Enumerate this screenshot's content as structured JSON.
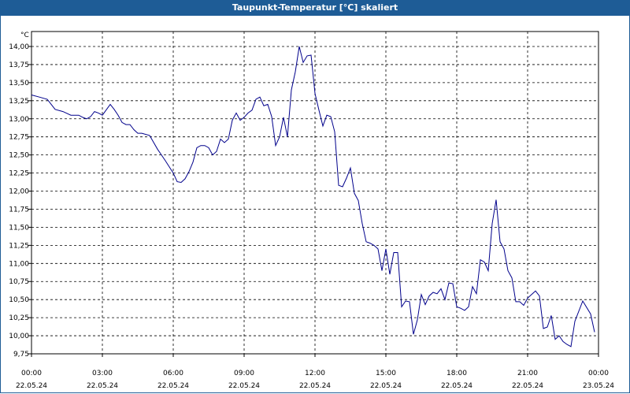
{
  "window": {
    "title": "Taupunkt-Temperatur [°C] skaliert"
  },
  "chart_data": {
    "type": "line",
    "title": "Taupunkt-Temperatur [°C] skaliert",
    "ylabel": "°C",
    "xlabel": "",
    "ylim": [
      9.75,
      14.0
    ],
    "yticks": [
      "14,00",
      "13,75",
      "13,50",
      "13,25",
      "13,00",
      "12,75",
      "12,50",
      "12,25",
      "12,00",
      "11,75",
      "11,50",
      "11,25",
      "11,00",
      "10,75",
      "10,50",
      "10,25",
      "10,00",
      "9,75"
    ],
    "xticks": [
      {
        "time": "00:00",
        "date": "22.05.24"
      },
      {
        "time": "03:00",
        "date": "22.05.24"
      },
      {
        "time": "06:00",
        "date": "22.05.24"
      },
      {
        "time": "09:00",
        "date": "22.05.24"
      },
      {
        "time": "12:00",
        "date": "22.05.24"
      },
      {
        "time": "15:00",
        "date": "22.05.24"
      },
      {
        "time": "18:00",
        "date": "22.05.24"
      },
      {
        "time": "21:00",
        "date": "22.05.24"
      },
      {
        "time": "00:00",
        "date": "23.05.24"
      }
    ],
    "grid": true,
    "line_color": "#00008b",
    "series": [
      {
        "x": [
          "00:00",
          "00:20",
          "00:40",
          "01:00",
          "01:20",
          "01:40",
          "02:00",
          "02:10",
          "02:20",
          "02:30",
          "02:40",
          "02:50",
          "03:00",
          "03:20",
          "03:30",
          "03:40",
          "03:50",
          "04:00",
          "04:10",
          "04:20",
          "04:30",
          "04:40",
          "05:00",
          "05:20",
          "05:30",
          "05:40",
          "06:00",
          "06:10",
          "06:20",
          "06:30",
          "06:40",
          "06:50",
          "07:00",
          "07:10",
          "07:20",
          "07:30",
          "07:40",
          "07:50",
          "08:00",
          "08:10",
          "08:20",
          "08:30",
          "08:40",
          "08:50",
          "09:00",
          "09:10",
          "09:20",
          "09:30",
          "09:40",
          "09:50",
          "10:00",
          "10:10",
          "10:20",
          "10:30",
          "10:40",
          "10:50",
          "11:00",
          "11:10",
          "11:20",
          "11:30",
          "11:40",
          "11:50",
          "12:00",
          "12:10",
          "12:20",
          "12:30",
          "12:40",
          "12:50",
          "13:00",
          "13:10",
          "13:20",
          "13:30",
          "13:40",
          "13:50",
          "14:00",
          "14:10",
          "14:20",
          "14:30",
          "14:40",
          "14:50",
          "15:00",
          "15:10",
          "15:20",
          "15:30",
          "15:40",
          "15:50",
          "16:00",
          "16:10",
          "16:20",
          "16:30",
          "16:40",
          "16:50",
          "17:00",
          "17:10",
          "17:20",
          "17:30",
          "17:40",
          "17:50",
          "18:00",
          "18:10",
          "18:20",
          "18:30",
          "18:40",
          "18:50",
          "19:00",
          "19:10",
          "19:20",
          "19:30",
          "19:40",
          "19:50",
          "20:00",
          "20:10",
          "20:20",
          "20:30",
          "20:40",
          "20:50",
          "21:00",
          "21:10",
          "21:20",
          "21:30",
          "21:40",
          "21:50",
          "22:00",
          "22:10",
          "22:20",
          "22:30",
          "22:40",
          "22:50",
          "23:00",
          "23:20",
          "23:40",
          "23:50"
        ],
        "y": [
          13.33,
          13.3,
          13.27,
          13.13,
          13.1,
          13.05,
          13.05,
          13.02,
          13.0,
          13.03,
          13.1,
          13.08,
          13.05,
          13.2,
          13.13,
          13.05,
          12.95,
          12.92,
          12.92,
          12.85,
          12.8,
          12.8,
          12.77,
          12.58,
          12.5,
          12.42,
          12.25,
          12.13,
          12.12,
          12.17,
          12.27,
          12.4,
          12.6,
          12.63,
          12.63,
          12.6,
          12.5,
          12.55,
          12.72,
          12.67,
          12.72,
          12.98,
          13.08,
          12.98,
          13.02,
          13.08,
          13.12,
          13.27,
          13.3,
          13.18,
          13.2,
          13.03,
          12.63,
          12.75,
          13.02,
          12.75,
          13.4,
          13.65,
          14.0,
          13.78,
          13.87,
          13.88,
          13.35,
          13.12,
          12.9,
          13.05,
          13.03,
          12.82,
          12.08,
          12.06,
          12.18,
          12.32,
          11.97,
          11.87,
          11.55,
          11.3,
          11.28,
          11.25,
          11.2,
          10.9,
          11.2,
          10.85,
          11.15,
          11.15,
          10.4,
          10.48,
          10.47,
          10.02,
          10.22,
          10.57,
          10.43,
          10.55,
          10.6,
          10.58,
          10.65,
          10.5,
          10.73,
          10.72,
          10.4,
          10.38,
          10.35,
          10.4,
          10.68,
          10.58,
          11.05,
          11.02,
          10.9,
          11.55,
          11.88,
          11.3,
          11.2,
          10.9,
          10.8,
          10.47,
          10.47,
          10.42,
          10.52,
          10.57,
          10.62,
          10.55,
          10.1,
          10.12,
          10.28,
          9.95,
          10.0,
          9.92,
          9.88,
          9.85,
          10.2,
          10.48,
          10.3,
          10.05
        ]
      }
    ]
  }
}
